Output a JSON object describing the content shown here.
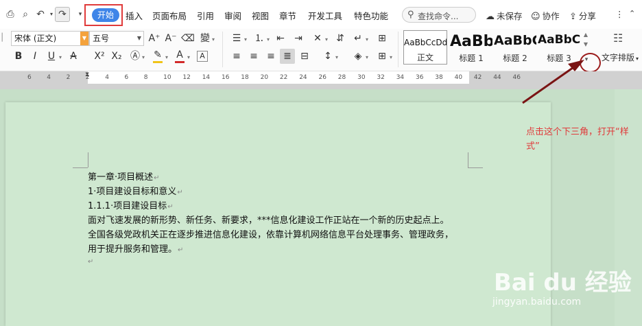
{
  "menu": {
    "tabs": [
      {
        "label": "开始",
        "active": true
      },
      {
        "label": "插入"
      },
      {
        "label": "页面布局"
      },
      {
        "label": "引用"
      },
      {
        "label": "审阅"
      },
      {
        "label": "视图"
      },
      {
        "label": "章节"
      },
      {
        "label": "开发工具"
      },
      {
        "label": "特色功能"
      }
    ],
    "search_placeholder": "查找命令...",
    "unsaved": "未保存",
    "collab": "协作",
    "share": "分享",
    "more": "⋮",
    "collapse": "⌃"
  },
  "ribbon": {
    "font_name": "宋体 (正文)",
    "font_size": "五号",
    "styles": [
      {
        "sample": "AaBbCcDd",
        "name": "正文"
      },
      {
        "sample": "AaBb",
        "name": "标题 1"
      },
      {
        "sample": "AaBbC",
        "name": "标题 2"
      },
      {
        "sample": "AaBbC",
        "name": "标题 3"
      }
    ],
    "text_layout_label": "文字排版",
    "highlight_color": "#f0c419",
    "font_color": "#d22a2a"
  },
  "ruler": {
    "numbers": [
      "6",
      "4",
      "2",
      "2",
      "4",
      "6",
      "8",
      "10",
      "12",
      "14",
      "16",
      "18",
      "20",
      "22",
      "24",
      "26",
      "28",
      "30",
      "32",
      "34",
      "36",
      "38",
      "40",
      "42",
      "44",
      "46"
    ]
  },
  "document": {
    "lines": [
      "第一章·项目概述",
      "1·项目建设目标和意义",
      "1.1.1·项目建设目标",
      "面对飞速发展的新形势、新任务、新要求，***信息化建设工作正站在一个新的历史起点上。",
      "全国各级党政机关正在逐步推进信息化建设，依靠计算机网络信息平台处理事务、管理政务，",
      "用于提升服务和管理。"
    ],
    "paragraph_mark": "↵"
  },
  "annotation": {
    "text": "点击这个下三角，打开“样式”",
    "color": "#e03a3a"
  },
  "watermark": {
    "logo": "Bai du 经验",
    "url": "jingyan.baidu.com"
  }
}
